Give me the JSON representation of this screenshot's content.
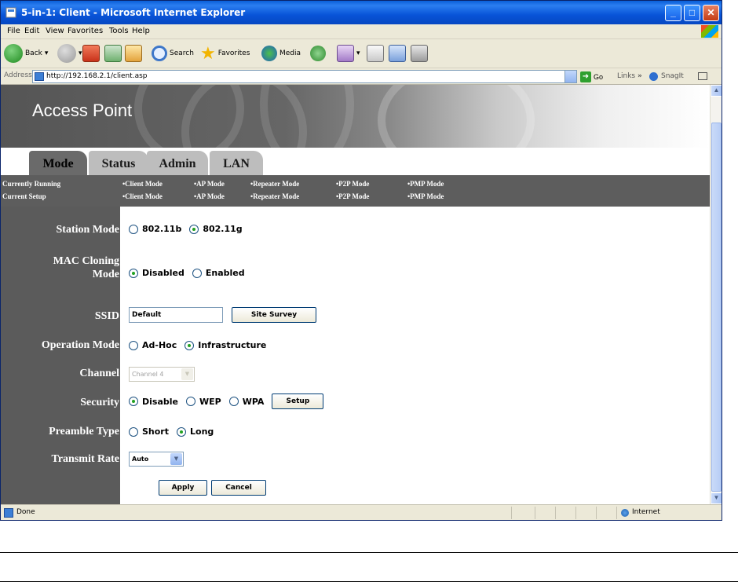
{
  "window": {
    "title": "5-in-1: Client - Microsoft Internet Explorer"
  },
  "menu": [
    "File",
    "Edit",
    "View",
    "Favorites",
    "Tools",
    "Help"
  ],
  "toolbar": {
    "back": "Back",
    "search": "Search",
    "favorites": "Favorites",
    "media": "Media"
  },
  "address": {
    "label": "Address",
    "url": "http://192.168.2.1/client.asp",
    "go": "Go",
    "links": "Links",
    "snagit": "SnagIt"
  },
  "banner": {
    "brand": "Access Point"
  },
  "tabs": [
    "Mode",
    "Status",
    "Admin",
    "LAN"
  ],
  "modebar": {
    "currently_running": "Currently Running",
    "current_setup": "Current Setup",
    "modes": [
      "•Client Mode",
      "•AP Mode",
      "•Repeater Mode",
      "•P2P Mode",
      "•PMP Mode"
    ]
  },
  "form": {
    "station_mode": {
      "label": "Station Mode",
      "options": [
        "802.11b",
        "802.11g"
      ],
      "selected": "802.11g"
    },
    "mac_cloning": {
      "label_line1": "MAC Cloning",
      "label_line2": "Mode",
      "options": [
        "Disabled",
        "Enabled"
      ],
      "selected": "Disabled"
    },
    "ssid": {
      "label": "SSID",
      "value": "Default",
      "survey_button": "Site Survey"
    },
    "operation_mode": {
      "label": "Operation Mode",
      "options": [
        "Ad-Hoc",
        "Infrastructure"
      ],
      "selected": "Infrastructure"
    },
    "channel": {
      "label": "Channel",
      "value": "Channel 4"
    },
    "security": {
      "label": "Security",
      "options": [
        "Disable",
        "WEP",
        "WPA"
      ],
      "selected": "Disable",
      "setup_button": "Setup"
    },
    "preamble": {
      "label": "Preamble Type",
      "options": [
        "Short",
        "Long"
      ],
      "selected": "Long"
    },
    "transmit_rate": {
      "label": "Transmit Rate",
      "value": "Auto"
    },
    "apply": "Apply",
    "cancel": "Cancel"
  },
  "statusbar": {
    "left": "Done",
    "zone": "Internet"
  }
}
